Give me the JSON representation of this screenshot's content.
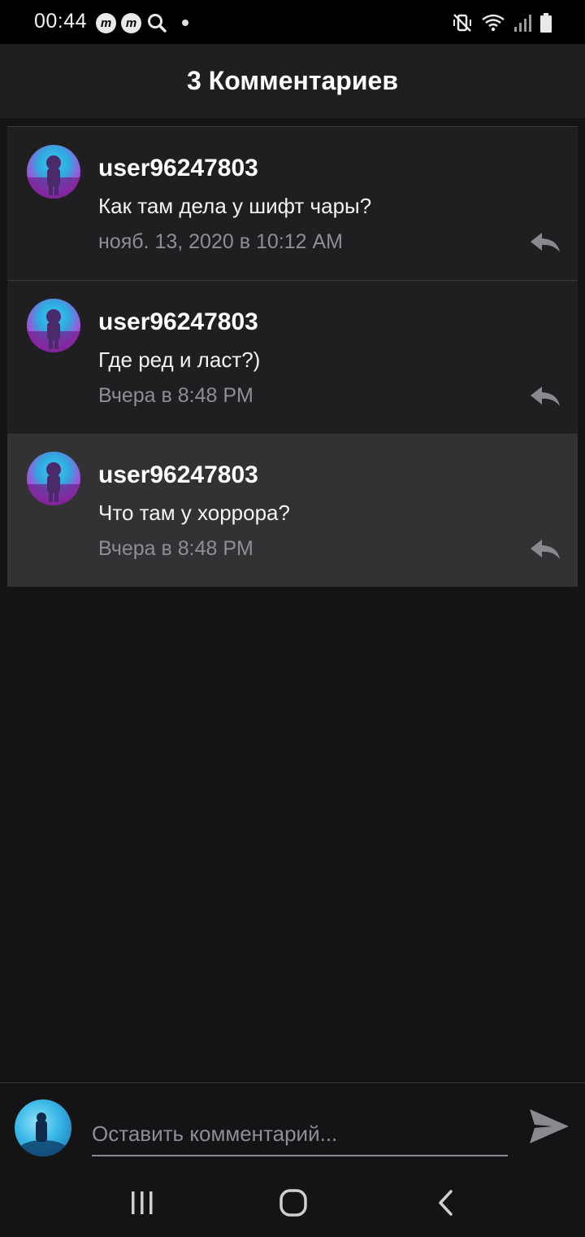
{
  "status_bar": {
    "time": "00:44",
    "badge_letter": "m",
    "icons": [
      "m-badge-icon",
      "m-badge-icon",
      "search-icon",
      "dot-icon",
      "mute-vibrate-icon",
      "wifi-icon",
      "signal-icon",
      "battery-icon"
    ]
  },
  "header": {
    "title": "3 Комментариев"
  },
  "comments": [
    {
      "user": "user96247803",
      "text": "Как там дела у шифт чары?",
      "time": "нояб. 13, 2020 в 10:12 AM"
    },
    {
      "user": "user96247803",
      "text": "Где ред и ласт?)",
      "time": "Вчера в 8:48 PM"
    },
    {
      "user": "user96247803",
      "text": "Что там у хоррора?",
      "time": "Вчера в 8:48 PM"
    }
  ],
  "compose": {
    "placeholder": "Оставить комментарий..."
  },
  "nav": {
    "icons": [
      "recent-apps-icon",
      "home-icon",
      "back-icon"
    ]
  },
  "colors": {
    "background": "#141316",
    "card": "#1f1e21",
    "highlight": "#323134",
    "muted_text": "#8f8e93"
  }
}
